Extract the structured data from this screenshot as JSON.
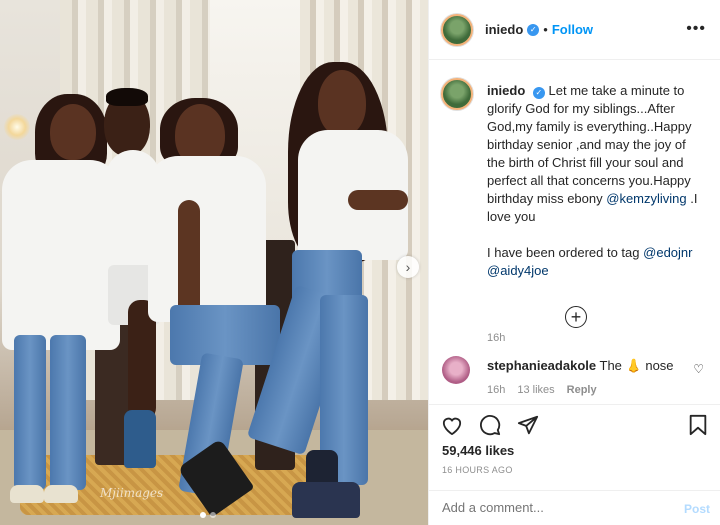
{
  "header": {
    "username": "iniedo",
    "bullet": "•",
    "follow_label": "Follow",
    "more_icon": "more-options-icon"
  },
  "caption": {
    "username": "iniedo",
    "text_part1": "Let me take a minute to glorify God for my siblings...After God,my family is everything..Happy birthday senior ,and may the joy of the birth of Christ fill your soul and perfect all that concerns you.Happy birthday miss ebony",
    "mention1": "@kemzyliving",
    "text_part2": ".I love you",
    "text_part3": "I have been ordered to tag",
    "mention2": "@edojnr",
    "mention3": "@aidy4joe",
    "time": "16h"
  },
  "comment": {
    "username": "stephanieadakole",
    "text_before": "The",
    "emoji": "👃",
    "text_after": "nose",
    "time": "16h",
    "likes": "13 likes",
    "reply": "Reply"
  },
  "actions": {
    "likes": "59,446 likes",
    "posted": "16 HOURS AGO"
  },
  "add_comment": {
    "placeholder": "Add a comment...",
    "post_label": "Post"
  },
  "photo": {
    "watermark": "Mjiimages"
  },
  "colors": {
    "link": "#00376b",
    "follow": "#0095f6",
    "verified": "#3897f0",
    "muted": "#8e8e8e"
  }
}
